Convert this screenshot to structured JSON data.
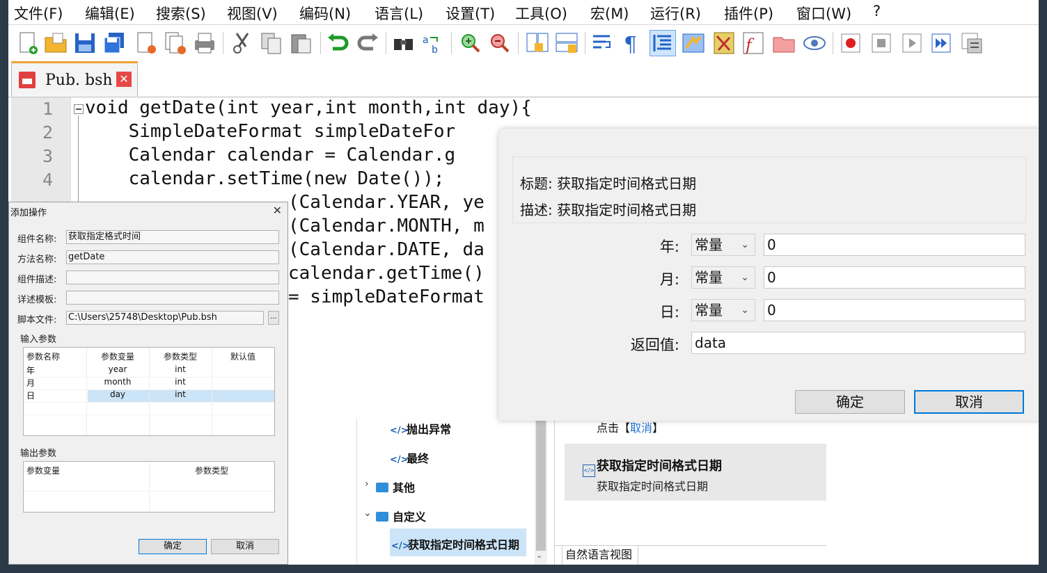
{
  "menu": [
    "文件(F)",
    "编辑(E)",
    "搜索(S)",
    "视图(V)",
    "编码(N)",
    "语言(L)",
    "设置(T)",
    "工具(O)",
    "宏(M)",
    "运行(R)",
    "插件(P)",
    "窗口(W)",
    "?"
  ],
  "tab": {
    "filename": "Pub. bsh",
    "close": "✕"
  },
  "editor": {
    "line_numbers": [
      "1",
      "2",
      "3",
      "4"
    ],
    "lines": [
      "void getDate(int year,int month,int day){",
      "    SimpleDateFormat simpleDateFor",
      "    Calendar calendar = Calendar.g",
      "    calendar.setTime(new Date());",
      "(Calendar.YEAR, ye",
      "(Calendar.MONTH, m",
      "(Calendar.DATE, da",
      "calendar.getTime()",
      "= simpleDateFormat"
    ]
  },
  "add_dialog": {
    "title": "添加操作",
    "close": "✕",
    "labels": {
      "component_name": "组件名称:",
      "method_name": "方法名称:",
      "component_desc": "组件描述:",
      "detail_template": "详述模板:",
      "script_file": "脚本文件:"
    },
    "values": {
      "component_name": "获取指定格式时间",
      "method_name": "getDate",
      "component_desc": "",
      "detail_template": "",
      "script_file": "C:\\Users\\25748\\Desktop\\Pub.bsh"
    },
    "browse": "...",
    "input_group": "输入参数",
    "input_headers": [
      "参数名称",
      "参数变量",
      "参数类型",
      "默认值"
    ],
    "input_rows": [
      [
        "年",
        "year",
        "int",
        ""
      ],
      [
        "月",
        "month",
        "int",
        ""
      ],
      [
        "日",
        "day",
        "int",
        ""
      ]
    ],
    "output_group": "输出参数",
    "output_headers": [
      "参数变量",
      "参数类型"
    ],
    "ok": "确定",
    "cancel": "取消"
  },
  "tree": {
    "items": [
      "抛出异常",
      "最终",
      "其他",
      "自定义",
      "获取指定时间格式日期"
    ],
    "code_icon": "</>"
  },
  "nl_panel": {
    "hint_prefix": "点击【",
    "hint_link": "取消",
    "hint_suffix": "】",
    "card_title": "获取指定时间格式日期",
    "card_desc": "获取指定时间格式日期",
    "tab_label": "自然语言视图"
  },
  "call_dialog": {
    "title_line": "标题: 获取指定时间格式日期",
    "desc_line": "描述: 获取指定时间格式日期",
    "fields": [
      {
        "label": "年:",
        "mode": "常量",
        "value": "0"
      },
      {
        "label": "月:",
        "mode": "常量",
        "value": "0"
      },
      {
        "label": "日:",
        "mode": "常量",
        "value": "0"
      }
    ],
    "return_label": "返回值:",
    "return_value": "data",
    "ok": "确定",
    "cancel": "取消"
  },
  "colors": {
    "accent": "#0078d7",
    "selection": "#cce4f7",
    "brand_tab": "#f0a030"
  }
}
